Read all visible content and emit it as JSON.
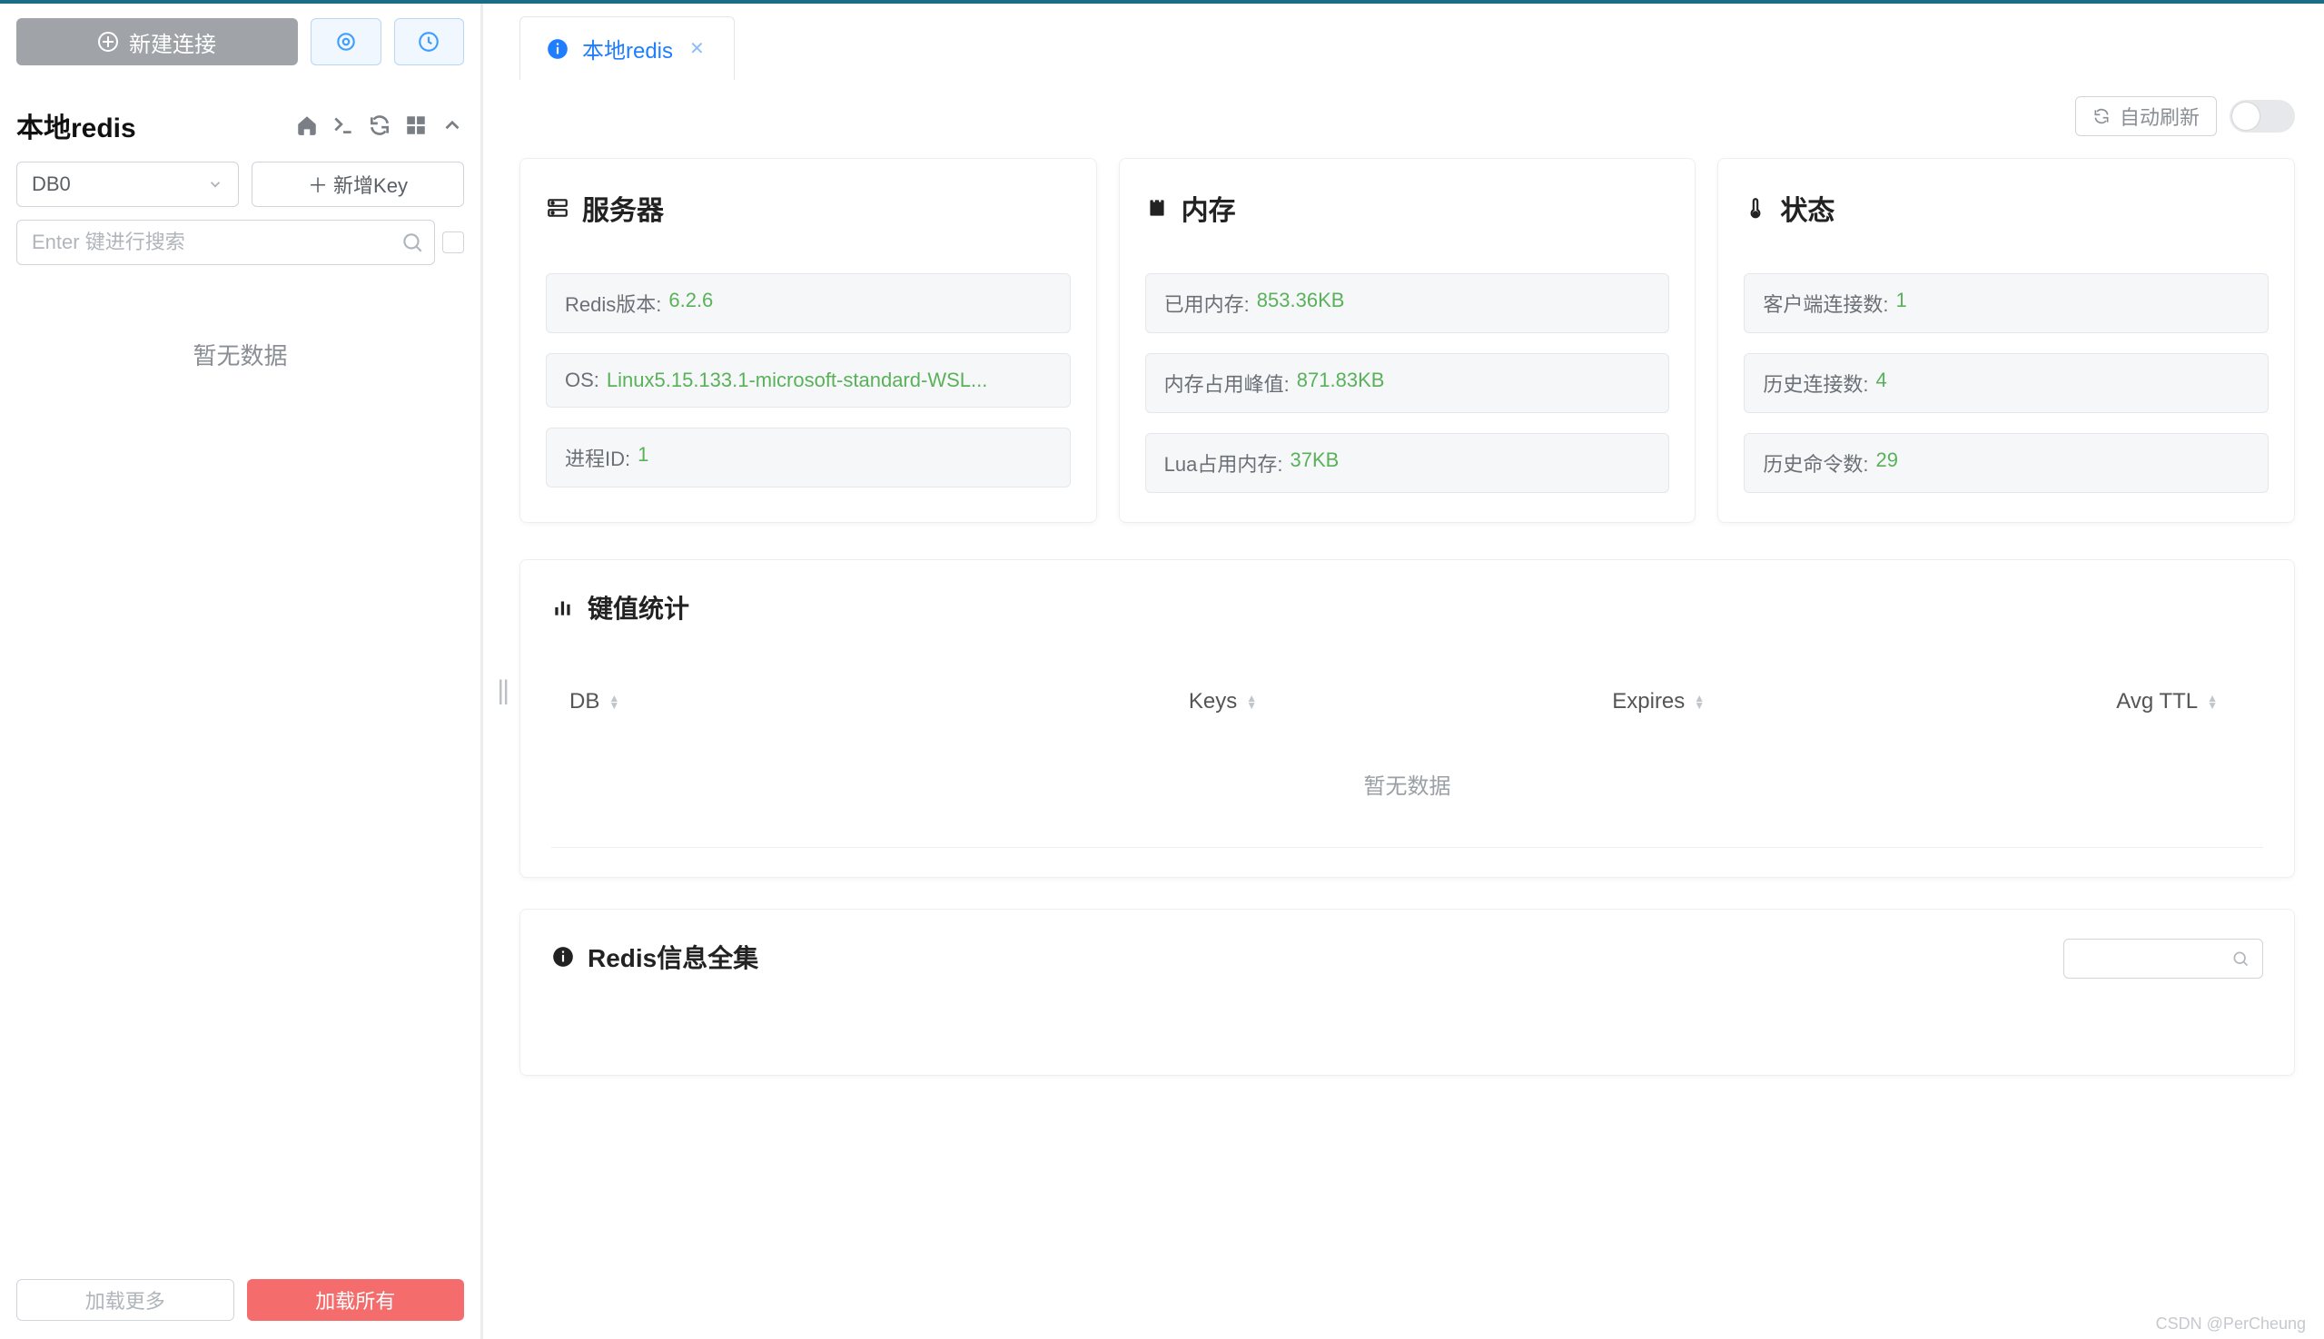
{
  "sidebar": {
    "new_connection_label": "新建连接",
    "connection_title": "本地redis",
    "db_select_value": "DB0",
    "new_key_label": "新增Key",
    "search_placeholder": "Enter 键进行搜索",
    "no_data_label": "暂无数据",
    "load_more_label": "加载更多",
    "load_all_label": "加载所有"
  },
  "tab": {
    "label": "本地redis"
  },
  "toolbar": {
    "auto_refresh_label": "自动刷新"
  },
  "cards": {
    "server": {
      "title": "服务器",
      "items": [
        {
          "label": "Redis版本: ",
          "value": "6.2.6"
        },
        {
          "label": "OS: ",
          "value": "Linux5.15.133.1-microsoft-standard-WSL..."
        },
        {
          "label": "进程ID: ",
          "value": "1"
        }
      ]
    },
    "memory": {
      "title": "内存",
      "items": [
        {
          "label": "已用内存: ",
          "value": "853.36KB"
        },
        {
          "label": "内存占用峰值: ",
          "value": "871.83KB"
        },
        {
          "label": "Lua占用内存: ",
          "value": "37KB"
        }
      ]
    },
    "status": {
      "title": "状态",
      "items": [
        {
          "label": "客户端连接数: ",
          "value": "1"
        },
        {
          "label": "历史连接数: ",
          "value": "4"
        },
        {
          "label": "历史命令数: ",
          "value": "29"
        }
      ]
    }
  },
  "keystats": {
    "title": "键值统计",
    "columns": {
      "db": "DB",
      "keys": "Keys",
      "expires": "Expires",
      "avg_ttl": "Avg TTL"
    },
    "empty_label": "暂无数据"
  },
  "infopanel": {
    "title": "Redis信息全集"
  },
  "watermark": "CSDN @PerCheung"
}
